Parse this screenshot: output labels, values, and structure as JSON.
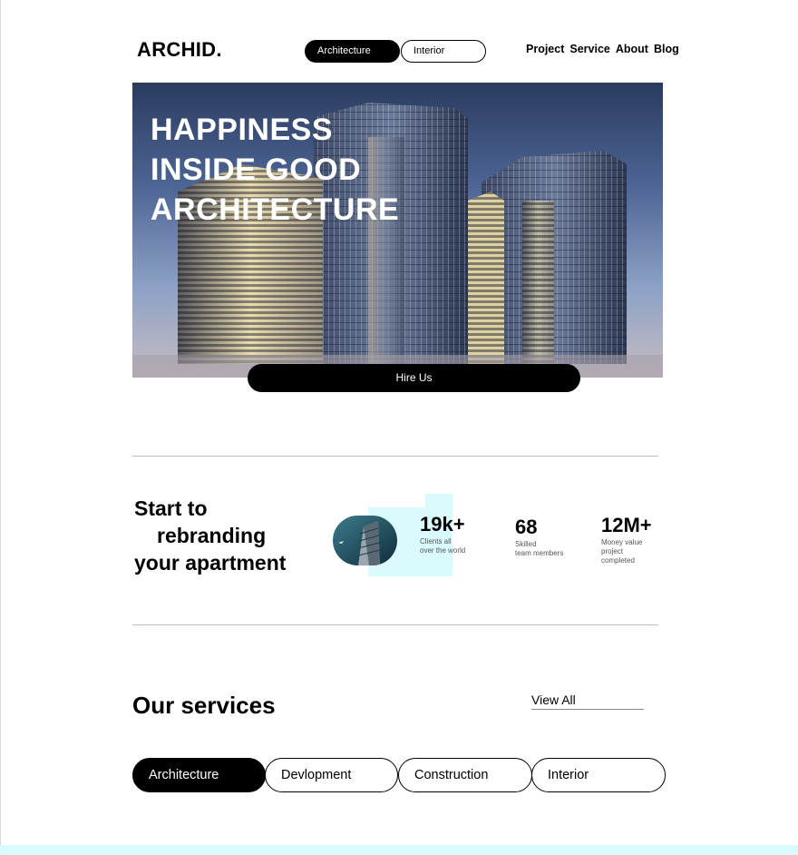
{
  "brand": {
    "logo": "ARCHID."
  },
  "category_toggle": {
    "items": [
      "Architecture",
      "Interior"
    ],
    "active": "Architecture"
  },
  "nav": {
    "items": [
      "Project",
      "Service",
      "About",
      "Blog"
    ]
  },
  "hero": {
    "title_lines": [
      "HAPPINESS",
      "INSIDE GOOD",
      "ARCHITECTURE"
    ],
    "cta_label": "Hire Us"
  },
  "stats_section": {
    "headline_lines": [
      "Start to",
      "rebranding",
      "your apartment"
    ],
    "stats": [
      {
        "value": "19k+",
        "desc_lines": [
          "Clients all",
          "over the world"
        ]
      },
      {
        "value": "68",
        "desc_lines": [
          "Skilled",
          "team members"
        ]
      },
      {
        "value": "12M+",
        "desc_lines": [
          "Money value",
          "project",
          "completed"
        ]
      }
    ],
    "accent_color": "#d9fbfd"
  },
  "services": {
    "title": "Our services",
    "view_all": "View All",
    "tabs": [
      "Architecture",
      "Devlopment",
      "Construction",
      "Interior"
    ],
    "active_tab": "Architecture"
  }
}
